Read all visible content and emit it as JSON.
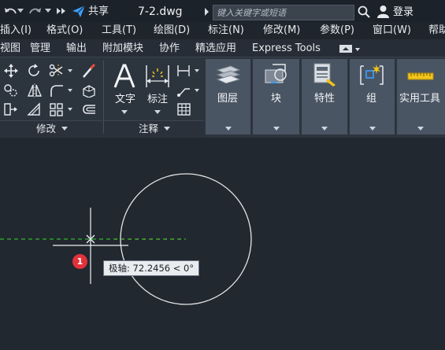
{
  "titlebar": {
    "back_icon": "arrow-left-icon",
    "forward_icon": "arrow-right-icon",
    "share_label": "共享",
    "file_title": "7-2.dwg",
    "search_placeholder": "键入关键字或短语",
    "login_label": "登录"
  },
  "menubar": {
    "items": [
      "插入(I)",
      "格式(O)",
      "工具(T)",
      "绘图(D)",
      "标注(N)",
      "修改(M)",
      "参数(P)",
      "窗口(W)",
      "帮助"
    ]
  },
  "ribbon_tabs": {
    "items": [
      "视图",
      "管理",
      "输出",
      "附加模块",
      "协作",
      "精选应用",
      "Express Tools"
    ]
  },
  "ribbon": {
    "modify_label": "修改",
    "annotate_label": "注释",
    "text_label": "文字",
    "dimension_label": "标注",
    "layers_label": "图层",
    "block_label": "块",
    "properties_label": "特性",
    "group_label": "组",
    "utilities_label": "实用工具"
  },
  "drawing": {
    "marker_number": "1",
    "tooltip": "极轴: 72.2456 < 0°",
    "colors": {
      "background": "#212830",
      "circle": "#e6e6e6",
      "polar_tracking": "#2eb82e",
      "marker": "#e3313a"
    }
  }
}
